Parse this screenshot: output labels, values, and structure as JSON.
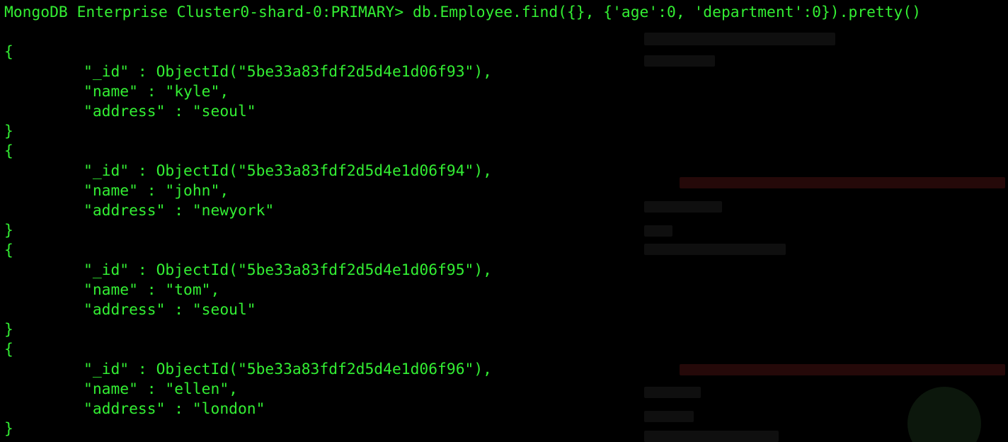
{
  "colors": {
    "background": "#000000",
    "text": "#33ee33"
  },
  "terminal": {
    "prompt": "MongoDB Enterprise Cluster0-shard-0:PRIMARY>",
    "command": "db.Employee.find({}, {'age':0, 'department':0}).pretty()",
    "documents": [
      {
        "open": "{",
        "id_line": "\"_id\" : ObjectId(\"5be33a83fdf2d5d4e1d06f93\"),",
        "name_line": "\"name\" : \"kyle\",",
        "address_line": "\"address\" : \"seoul\"",
        "close": "}"
      },
      {
        "open": "{",
        "id_line": "\"_id\" : ObjectId(\"5be33a83fdf2d5d4e1d06f94\"),",
        "name_line": "\"name\" : \"john\",",
        "address_line": "\"address\" : \"newyork\"",
        "close": "}"
      },
      {
        "open": "{",
        "id_line": "\"_id\" : ObjectId(\"5be33a83fdf2d5d4e1d06f95\"),",
        "name_line": "\"name\" : \"tom\",",
        "address_line": "\"address\" : \"seoul\"",
        "close": "}"
      },
      {
        "open": "{",
        "id_line": "\"_id\" : ObjectId(\"5be33a83fdf2d5d4e1d06f96\"),",
        "name_line": "\"name\" : \"ellen\",",
        "address_line": "\"address\" : \"london\"",
        "close": "}"
      }
    ]
  }
}
